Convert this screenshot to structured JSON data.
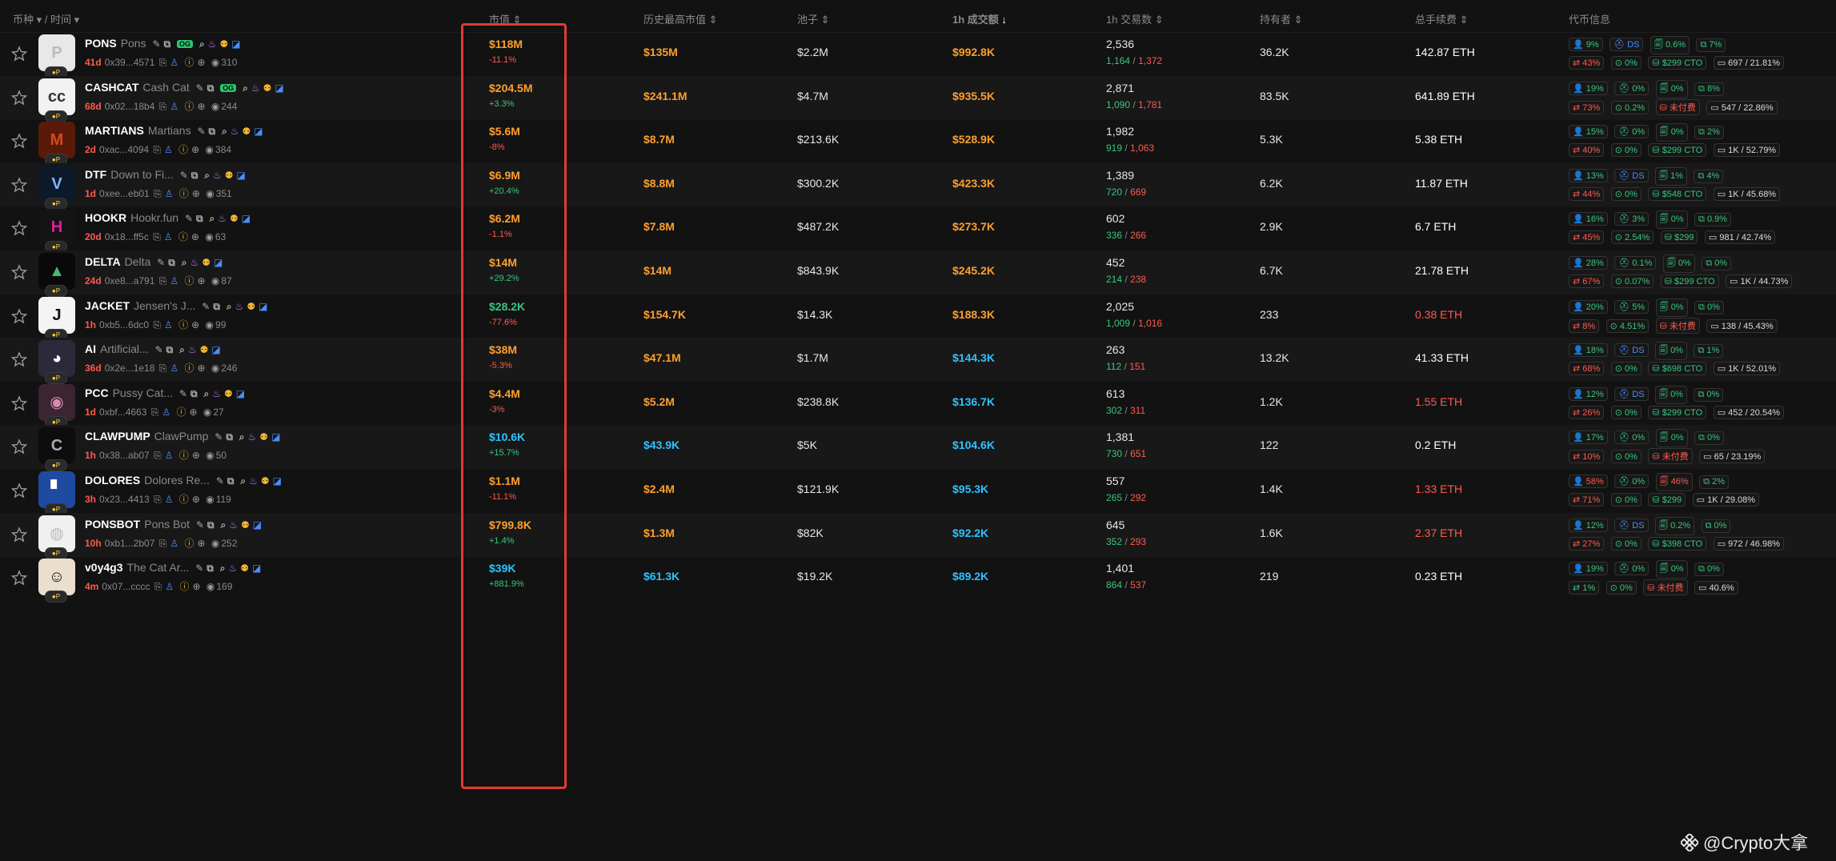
{
  "header": {
    "col_token": "币种",
    "col_sep": "/",
    "col_time": "时间",
    "col_mcap": "市值",
    "col_ath": "历史最高市值",
    "col_pool": "池子",
    "col_vol": "1h 成交额",
    "col_tx": "1h 交易数",
    "col_holders": "持有者",
    "col_fee": "总手续费",
    "col_info": "代币信息"
  },
  "colors": {
    "orange": "#ff9f2e",
    "green": "#37c77f",
    "red": "#ff5a4e",
    "cyan": "#2ec3ff",
    "highlight": "#e23a34"
  },
  "rows": [
    {
      "symbol": "PONS",
      "name": "Pons",
      "og": "OG",
      "age": "41d",
      "addr": "0x39...4571",
      "views": "310",
      "mcap": "$118M",
      "mcap_chg": "-11.1%",
      "ath": "$135M",
      "pool": "$2.2M",
      "vol": "$992.8K",
      "tx": "2,536",
      "buys": "1,164",
      "sells": "1,372",
      "holders": "36.2K",
      "fee": "142.87 ETH",
      "t1": "9%",
      "t2": "DS",
      "t3": "0.6%",
      "t4": "7%",
      "t5": "43%",
      "t6": "0%",
      "t7": "$299 CTO",
      "t8": "697 / 21.81%"
    },
    {
      "symbol": "CASHCAT",
      "name": "Cash Cat",
      "og": "OG",
      "age": "68d",
      "addr": "0x02...18b4",
      "views": "244",
      "mcap": "$204.5M",
      "mcap_chg": "+3.3%",
      "ath": "$241.1M",
      "pool": "$4.7M",
      "vol": "$935.5K",
      "tx": "2,871",
      "buys": "1,090",
      "sells": "1,781",
      "holders": "83.5K",
      "fee": "641.89 ETH",
      "t1": "19%",
      "t2": "0%",
      "t3": "0%",
      "t4": "8%",
      "t5": "73%",
      "t6": "0.2%",
      "t7": "未付费",
      "t8": "547 / 22.86%"
    },
    {
      "symbol": "MARTIANS",
      "name": "Martians",
      "og": "",
      "age": "2d",
      "addr": "0xac...4094",
      "views": "384",
      "mcap": "$5.6M",
      "mcap_chg": "-8%",
      "ath": "$8.7M",
      "pool": "$213.6K",
      "vol": "$528.9K",
      "tx": "1,982",
      "buys": "919",
      "sells": "1,063",
      "holders": "5.3K",
      "fee": "5.38 ETH",
      "t1": "15%",
      "t2": "0%",
      "t3": "0%",
      "t4": "2%",
      "t5": "40%",
      "t6": "0%",
      "t7": "$299 CTO",
      "t8": "1K / 52.79%"
    },
    {
      "symbol": "DTF",
      "name": "Down to Fi...",
      "og": "",
      "age": "1d",
      "addr": "0xee...eb01",
      "views": "351",
      "mcap": "$6.9M",
      "mcap_chg": "+20.4%",
      "ath": "$8.8M",
      "pool": "$300.2K",
      "vol": "$423.3K",
      "tx": "1,389",
      "buys": "720",
      "sells": "669",
      "holders": "6.2K",
      "fee": "11.87 ETH",
      "t1": "13%",
      "t2": "DS",
      "t3": "1%",
      "t4": "4%",
      "t5": "44%",
      "t6": "0%",
      "t7": "$548 CTO",
      "t8": "1K / 45.68%"
    },
    {
      "symbol": "HOOKR",
      "name": "Hookr.fun",
      "og": "",
      "age": "20d",
      "addr": "0x18...ff5c",
      "views": "63",
      "mcap": "$6.2M",
      "mcap_chg": "-1.1%",
      "ath": "$7.8M",
      "pool": "$487.2K",
      "vol": "$273.7K",
      "tx": "602",
      "buys": "336",
      "sells": "266",
      "holders": "2.9K",
      "fee": "6.7 ETH",
      "t1": "16%",
      "t2": "3%",
      "t3": "0%",
      "t4": "0.9%",
      "t5": "45%",
      "t6": "2.54%",
      "t7": "$299",
      "t8": "981 / 42.74%"
    },
    {
      "symbol": "DELTA",
      "name": "Delta",
      "og": "",
      "age": "24d",
      "addr": "0xe8...a791",
      "views": "87",
      "mcap": "$14M",
      "mcap_chg": "+29.2%",
      "ath": "$14M",
      "pool": "$843.9K",
      "vol": "$245.2K",
      "tx": "452",
      "buys": "214",
      "sells": "238",
      "holders": "6.7K",
      "fee": "21.78 ETH",
      "t1": "28%",
      "t2": "0.1%",
      "t3": "0%",
      "t4": "0%",
      "t5": "67%",
      "t6": "0.07%",
      "t7": "$299 CTO",
      "t8": "1K / 44.73%"
    },
    {
      "symbol": "JACKET",
      "name": "Jensen's J...",
      "og": "",
      "age": "1h",
      "addr": "0xb5...6dc0",
      "views": "99",
      "mcap": "$28.2K",
      "mcap_chg": "-77.6%",
      "ath": "$154.7K",
      "pool": "$14.3K",
      "vol": "$188.3K",
      "tx": "2,025",
      "buys": "1,009",
      "sells": "1,016",
      "holders": "233",
      "fee": "0.38 ETH",
      "t1": "20%",
      "t2": "5%",
      "t3": "0%",
      "t4": "0%",
      "t5": "8%",
      "t6": "4.51%",
      "t7": "未付费",
      "t8": "138 / 45.43%"
    },
    {
      "symbol": "AI",
      "name": "Artificial...",
      "og": "",
      "age": "36d",
      "addr": "0x2e...1e18",
      "views": "246",
      "mcap": "$38M",
      "mcap_chg": "-5.3%",
      "ath": "$47.1M",
      "pool": "$1.7M",
      "vol": "$144.3K",
      "tx": "263",
      "buys": "112",
      "sells": "151",
      "holders": "13.2K",
      "fee": "41.33 ETH",
      "t1": "18%",
      "t2": "DS",
      "t3": "0%",
      "t4": "1%",
      "t5": "68%",
      "t6": "0%",
      "t7": "$698 CTO",
      "t8": "1K / 52.01%"
    },
    {
      "symbol": "PCC",
      "name": "Pussy Cat...",
      "og": "",
      "age": "1d",
      "addr": "0xbf...4663",
      "views": "27",
      "mcap": "$4.4M",
      "mcap_chg": "-3%",
      "ath": "$5.2M",
      "pool": "$238.8K",
      "vol": "$136.7K",
      "tx": "613",
      "buys": "302",
      "sells": "311",
      "holders": "1.2K",
      "fee": "1.55 ETH",
      "t1": "12%",
      "t2": "DS",
      "t3": "0%",
      "t4": "0%",
      "t5": "26%",
      "t6": "0%",
      "t7": "$299 CTO",
      "t8": "452 / 20.54%"
    },
    {
      "symbol": "CLAWPUMP",
      "name": "ClawPump",
      "og": "",
      "age": "1h",
      "addr": "0x38...ab07",
      "views": "50",
      "mcap": "$10.6K",
      "mcap_chg": "+15.7%",
      "ath": "$43.9K",
      "pool": "$5K",
      "vol": "$104.6K",
      "tx": "1,381",
      "buys": "730",
      "sells": "651",
      "holders": "122",
      "fee": "0.2 ETH",
      "t1": "17%",
      "t2": "0%",
      "t3": "0%",
      "t4": "0%",
      "t5": "10%",
      "t6": "0%",
      "t7": "未付费",
      "t8": "65 / 23.19%"
    },
    {
      "symbol": "DOLORES",
      "name": "Dolores Re...",
      "og": "",
      "age": "3h",
      "addr": "0x23...4413",
      "views": "119",
      "mcap": "$1.1M",
      "mcap_chg": "-11.1%",
      "ath": "$2.4M",
      "pool": "$121.9K",
      "vol": "$95.3K",
      "tx": "557",
      "buys": "265",
      "sells": "292",
      "holders": "1.4K",
      "fee": "1.33 ETH",
      "t1": "58%",
      "t2": "0%",
      "t3": "46%",
      "t4": "2%",
      "t5": "71%",
      "t6": "0%",
      "t7": "$299",
      "t8": "1K / 29.08%"
    },
    {
      "symbol": "PONSBOT",
      "name": "Pons Bot",
      "og": "",
      "age": "10h",
      "addr": "0xb1...2b07",
      "views": "252",
      "mcap": "$799.8K",
      "mcap_chg": "+1.4%",
      "ath": "$1.3M",
      "pool": "$82K",
      "vol": "$92.2K",
      "tx": "645",
      "buys": "352",
      "sells": "293",
      "holders": "1.6K",
      "fee": "2.37 ETH",
      "t1": "12%",
      "t2": "DS",
      "t3": "0.2%",
      "t4": "0%",
      "t5": "27%",
      "t6": "0%",
      "t7": "$398 CTO",
      "t8": "972 / 46.98%"
    },
    {
      "symbol": "v0y4g3",
      "name": "The Cat Ar...",
      "og": "",
      "age": "4m",
      "addr": "0x07...cccc",
      "views": "169",
      "mcap": "$39K",
      "mcap_chg": "+881.9%",
      "ath": "$61.3K",
      "pool": "$19.2K",
      "vol": "$89.2K",
      "tx": "1,401",
      "buys": "864",
      "sells": "537",
      "holders": "219",
      "fee": "0.23 ETH",
      "t1": "19%",
      "t2": "0%",
      "t3": "0%",
      "t4": "0%",
      "t5": "1%",
      "t6": "0%",
      "t7": "未付费",
      "t8": "40.6%"
    }
  ],
  "watermark": "@Crypto大拿"
}
